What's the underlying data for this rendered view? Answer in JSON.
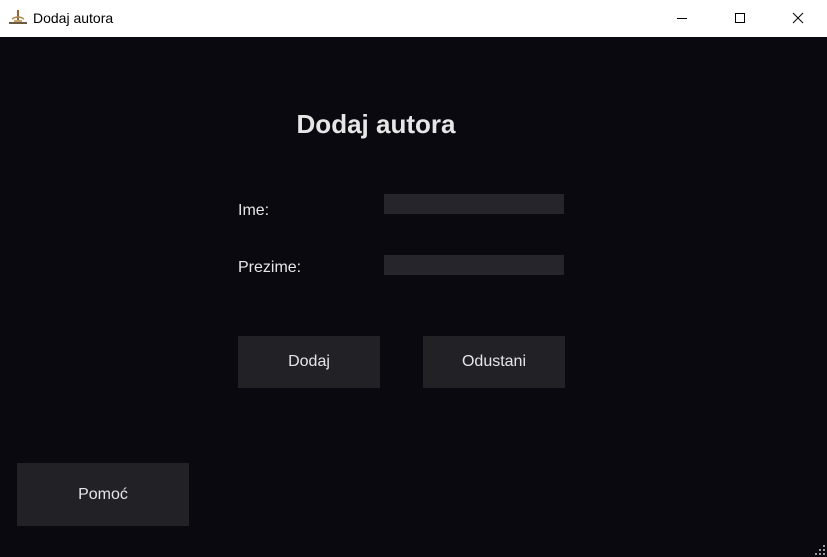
{
  "window": {
    "title": "Dodaj autora",
    "icon": "app-logo-icon",
    "controls": [
      "minimize-icon",
      "maximize-icon",
      "close-icon"
    ]
  },
  "form": {
    "heading": "Dodaj autora",
    "fields": {
      "ime": {
        "label": "Ime:",
        "value": ""
      },
      "prezime": {
        "label": "Prezime:",
        "value": ""
      }
    },
    "buttons": {
      "dodaj": "Dodaj",
      "odustani": "Odustani"
    }
  },
  "help_button": "Pomoć",
  "colors": {
    "background": "#0b0910",
    "field": "#26252b",
    "button": "#222126",
    "text": "#e6e6e6"
  }
}
